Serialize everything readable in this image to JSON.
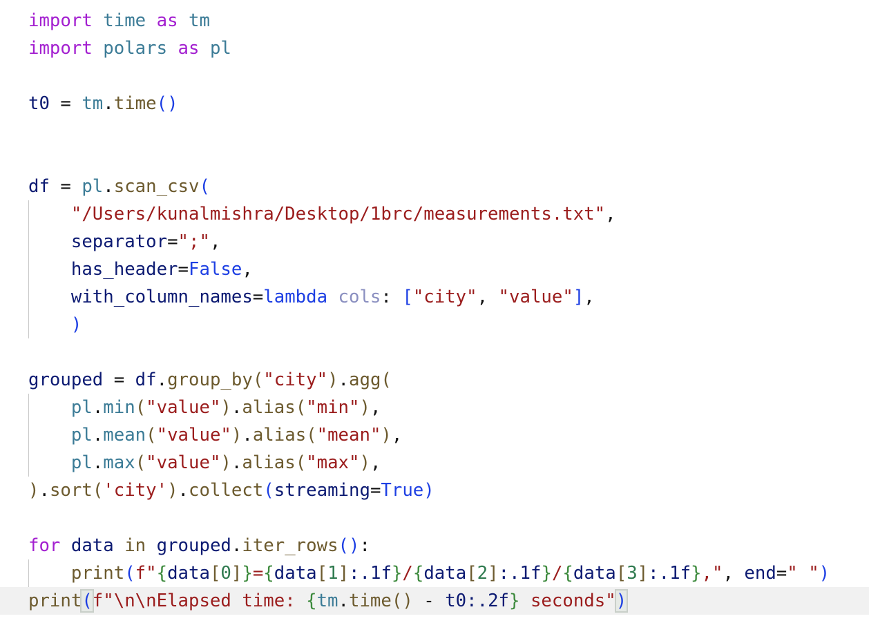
{
  "editor": {
    "language": "python",
    "colors": {
      "keyword": "#a31fd0",
      "module": "#3b7b96",
      "function": "#6c5a2e",
      "variable": "#0c1a72",
      "paren": "#1d3fe3",
      "string": "#9b1d1d",
      "fstring_brace": "#3d8a3d",
      "current_line": "#f1f1f1"
    },
    "lines": [
      [
        [
          "import",
          "kw"
        ],
        [
          " ",
          ""
        ],
        [
          "time",
          "mod"
        ],
        [
          " ",
          ""
        ],
        [
          "as",
          "kw"
        ],
        [
          " ",
          ""
        ],
        [
          "tm",
          "mod"
        ]
      ],
      [
        [
          "import",
          "kw"
        ],
        [
          " ",
          ""
        ],
        [
          "polars",
          "mod"
        ],
        [
          " ",
          ""
        ],
        [
          "as",
          "kw"
        ],
        [
          " ",
          ""
        ],
        [
          "pl",
          "mod"
        ]
      ],
      [],
      [
        [
          "t0",
          "var"
        ],
        [
          " = ",
          "op"
        ],
        [
          "tm",
          "mod"
        ],
        [
          ".",
          "op"
        ],
        [
          "time",
          "fn"
        ],
        [
          "()",
          "par"
        ]
      ],
      [],
      [],
      [
        [
          "df",
          "var"
        ],
        [
          " = ",
          "op"
        ],
        [
          "pl",
          "mod"
        ],
        [
          ".",
          "op"
        ],
        [
          "scan_csv",
          "fn"
        ],
        [
          "(",
          "par"
        ]
      ],
      [
        [
          "    ",
          ""
        ],
        [
          "\"/Users/kunalmishra/Desktop/1brc/measurements.txt\"",
          "str"
        ],
        [
          ",",
          "op"
        ]
      ],
      [
        [
          "    ",
          ""
        ],
        [
          "separator",
          "var"
        ],
        [
          "=",
          "op"
        ],
        [
          "\";\"",
          "str"
        ],
        [
          ",",
          "op"
        ]
      ],
      [
        [
          "    ",
          ""
        ],
        [
          "has_header",
          "var"
        ],
        [
          "=",
          "op"
        ],
        [
          "False",
          "const"
        ],
        [
          ",",
          "op"
        ]
      ],
      [
        [
          "    ",
          ""
        ],
        [
          "with_column_names",
          "var"
        ],
        [
          "=",
          "op"
        ],
        [
          "lambda",
          "const"
        ],
        [
          " ",
          ""
        ],
        [
          "cols",
          "param"
        ],
        [
          ": ",
          "op"
        ],
        [
          "[",
          "par"
        ],
        [
          "\"city\"",
          "str"
        ],
        [
          ", ",
          "op"
        ],
        [
          "\"value\"",
          "str"
        ],
        [
          "]",
          "par"
        ],
        [
          ",",
          "op"
        ]
      ],
      [
        [
          "    ",
          ""
        ],
        [
          ")",
          "par"
        ]
      ],
      [],
      [
        [
          "grouped",
          "var"
        ],
        [
          " = ",
          "op"
        ],
        [
          "df",
          "var"
        ],
        [
          ".",
          "op"
        ],
        [
          "group_by",
          "fn"
        ],
        [
          "(",
          "fn"
        ],
        [
          "\"city\"",
          "str"
        ],
        [
          ")",
          "fn"
        ],
        [
          ".",
          "op"
        ],
        [
          "agg",
          "fn"
        ],
        [
          "(",
          "fn"
        ]
      ],
      [
        [
          "    ",
          ""
        ],
        [
          "pl",
          "mod"
        ],
        [
          ".",
          "op"
        ],
        [
          "min",
          "mod"
        ],
        [
          "(",
          "fn"
        ],
        [
          "\"value\"",
          "str"
        ],
        [
          ")",
          "fn"
        ],
        [
          ".",
          "op"
        ],
        [
          "alias",
          "fn"
        ],
        [
          "(",
          "fn"
        ],
        [
          "\"min\"",
          "str"
        ],
        [
          ")",
          "fn"
        ],
        [
          ",",
          "op"
        ]
      ],
      [
        [
          "    ",
          ""
        ],
        [
          "pl",
          "mod"
        ],
        [
          ".",
          "op"
        ],
        [
          "mean",
          "mod"
        ],
        [
          "(",
          "fn"
        ],
        [
          "\"value\"",
          "str"
        ],
        [
          ")",
          "fn"
        ],
        [
          ".",
          "op"
        ],
        [
          "alias",
          "fn"
        ],
        [
          "(",
          "fn"
        ],
        [
          "\"mean\"",
          "str"
        ],
        [
          ")",
          "fn"
        ],
        [
          ",",
          "op"
        ]
      ],
      [
        [
          "    ",
          ""
        ],
        [
          "pl",
          "mod"
        ],
        [
          ".",
          "op"
        ],
        [
          "max",
          "mod"
        ],
        [
          "(",
          "fn"
        ],
        [
          "\"value\"",
          "str"
        ],
        [
          ")",
          "fn"
        ],
        [
          ".",
          "op"
        ],
        [
          "alias",
          "fn"
        ],
        [
          "(",
          "fn"
        ],
        [
          "\"max\"",
          "str"
        ],
        [
          ")",
          "fn"
        ],
        [
          ",",
          "op"
        ]
      ],
      [
        [
          ")",
          "fn"
        ],
        [
          ".",
          "op"
        ],
        [
          "sort",
          "fn"
        ],
        [
          "(",
          "fn"
        ],
        [
          "'city'",
          "str"
        ],
        [
          ")",
          "fn"
        ],
        [
          ".",
          "op"
        ],
        [
          "collect",
          "fn"
        ],
        [
          "(",
          "par"
        ],
        [
          "streaming",
          "var"
        ],
        [
          "=",
          "op"
        ],
        [
          "True",
          "const"
        ],
        [
          ")",
          "par"
        ]
      ],
      [],
      [
        [
          "for",
          "kw"
        ],
        [
          " ",
          ""
        ],
        [
          "data",
          "var"
        ],
        [
          " ",
          ""
        ],
        [
          "in",
          "fn"
        ],
        [
          " ",
          ""
        ],
        [
          "grouped",
          "var"
        ],
        [
          ".",
          "op"
        ],
        [
          "iter_rows",
          "fn"
        ],
        [
          "()",
          "par"
        ],
        [
          ":",
          "op"
        ]
      ],
      [
        [
          "    ",
          ""
        ],
        [
          "print",
          "fn"
        ],
        [
          "(",
          "par"
        ],
        [
          "f\"",
          "str"
        ],
        [
          "{",
          "fb"
        ],
        [
          "data",
          "var"
        ],
        [
          "[",
          "fn"
        ],
        [
          "0",
          "idx"
        ],
        [
          "]",
          "fn"
        ],
        [
          "}",
          "fb"
        ],
        [
          "=",
          "str"
        ],
        [
          "{",
          "fb"
        ],
        [
          "data",
          "var"
        ],
        [
          "[",
          "fn"
        ],
        [
          "1",
          "idx"
        ],
        [
          "]",
          "fn"
        ],
        [
          ":.1f",
          "var"
        ],
        [
          "}",
          "fb"
        ],
        [
          "/",
          "str"
        ],
        [
          "{",
          "fb"
        ],
        [
          "data",
          "var"
        ],
        [
          "[",
          "fn"
        ],
        [
          "2",
          "idx"
        ],
        [
          "]",
          "fn"
        ],
        [
          ":.1f",
          "var"
        ],
        [
          "}",
          "fb"
        ],
        [
          "/",
          "str"
        ],
        [
          "{",
          "fb"
        ],
        [
          "data",
          "var"
        ],
        [
          "[",
          "fn"
        ],
        [
          "3",
          "idx"
        ],
        [
          "]",
          "fn"
        ],
        [
          ":.1f",
          "var"
        ],
        [
          "}",
          "fb"
        ],
        [
          ",\"",
          "str"
        ],
        [
          ", ",
          "op"
        ],
        [
          "end",
          "var"
        ],
        [
          "=",
          "op"
        ],
        [
          "\" \"",
          "str"
        ],
        [
          ")",
          "par"
        ]
      ],
      [
        [
          "print",
          "fn"
        ],
        [
          "(",
          "par match"
        ],
        [
          "f\"",
          "str"
        ],
        [
          "\\n\\n",
          "str"
        ],
        [
          "Elapsed time: ",
          "str"
        ],
        [
          "{",
          "fb"
        ],
        [
          "tm",
          "mod"
        ],
        [
          ".",
          "op"
        ],
        [
          "time",
          "fn"
        ],
        [
          "()",
          "fn"
        ],
        [
          " - ",
          "op"
        ],
        [
          "t0",
          "var"
        ],
        [
          ":.2f",
          "var"
        ],
        [
          "}",
          "fb"
        ],
        [
          " seconds\"",
          "str"
        ],
        [
          ")",
          "par match"
        ]
      ]
    ],
    "guided_lines": [
      7,
      8,
      9,
      10,
      11,
      14,
      15,
      16,
      20
    ],
    "current_line": 21
  }
}
